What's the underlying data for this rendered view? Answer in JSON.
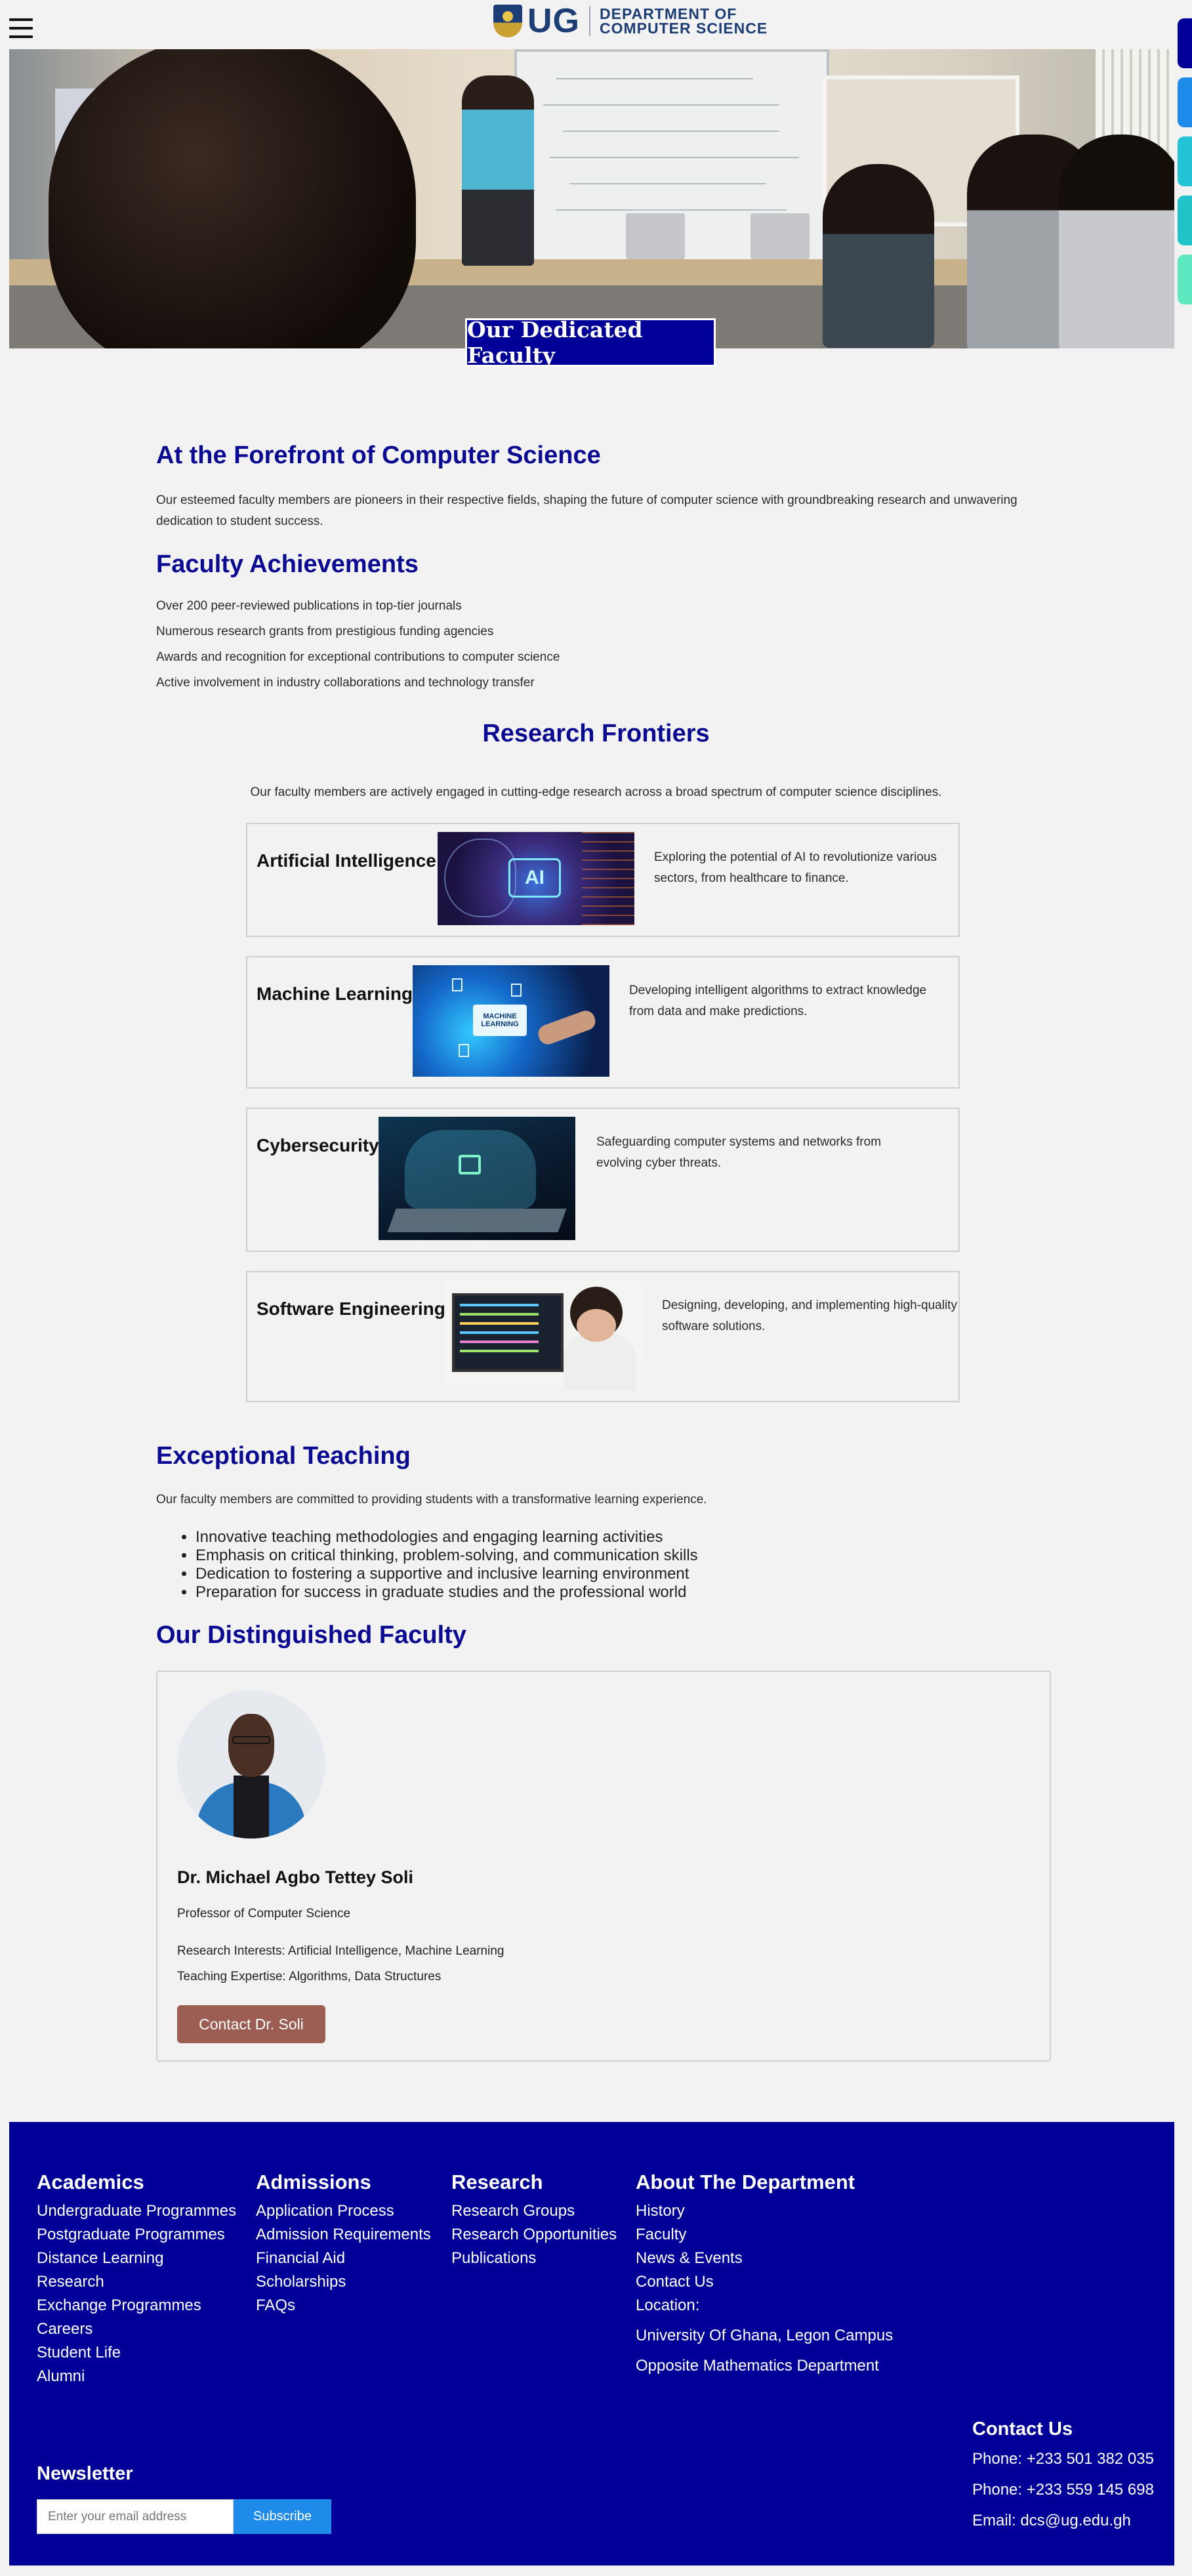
{
  "header": {
    "logo_ug": "UG",
    "logo_dept_line1": "DEPARTMENT OF",
    "logo_dept_line2": "COMPUTER SCIENCE",
    "side_tab_colors": [
      "#000099",
      "#1e8bea",
      "#22c3d6",
      "#20c4c8",
      "#5ee8c0"
    ]
  },
  "hero": {
    "title": "Our Dedicated Faculty"
  },
  "intro": {
    "heading": "At the Forefront of Computer Science",
    "text": "Our esteemed faculty members are pioneers in their respective fields, shaping the future of computer science with groundbreaking research and unwavering dedication to student success."
  },
  "achievements": {
    "heading": "Faculty Achievements",
    "items": [
      "Over 200 peer-reviewed publications in top-tier journals",
      "Numerous research grants from prestigious funding agencies",
      "Awards and recognition for exceptional contributions to computer science",
      "Active involvement in industry collaborations and technology transfer"
    ]
  },
  "research": {
    "heading": "Research Frontiers",
    "intro": "Our faculty members are actively engaged in cutting-edge research across a broad spectrum of computer science disciplines.",
    "areas": [
      {
        "title": "Artificial Intelligence",
        "badge": "AI",
        "desc": "Exploring the potential of AI to revolutionize various sectors, from healthcare to finance."
      },
      {
        "title": "Machine Learning",
        "badge": "MACHINE LEARNING",
        "desc": "Developing intelligent algorithms to extract knowledge from data and make predictions."
      },
      {
        "title": "Cybersecurity",
        "desc": "Safeguarding computer systems and networks from evolving cyber threats."
      },
      {
        "title": "Software Engineering",
        "desc": "Designing, developing, and implementing high-quality software solutions."
      }
    ]
  },
  "teaching": {
    "heading": "Exceptional Teaching",
    "text": "Our faculty members are committed to providing students with a transformative learning experience.",
    "items": [
      "Innovative teaching methodologies and engaging learning activities",
      "Emphasis on critical thinking, problem-solving, and communication skills",
      "Dedication to fostering a supportive and inclusive learning environment",
      "Preparation for success in graduate studies and the professional world"
    ]
  },
  "faculty": {
    "heading": "Our Distinguished Faculty",
    "name": "Dr. Michael Agbo Tettey Soli",
    "role": "Professor of Computer Science",
    "interests": "Research Interests: Artificial Intelligence, Machine Learning",
    "expertise": "Teaching Expertise: Algorithms, Data Structures",
    "button": "Contact Dr. Soli"
  },
  "footer": {
    "academics": {
      "heading": "Academics",
      "links": [
        "Undergraduate Programmes",
        "Postgraduate Programmes",
        "Distance Learning",
        "Research",
        "Exchange Programmes",
        "Careers",
        "Student Life",
        "Alumni"
      ]
    },
    "admissions": {
      "heading": "Admissions",
      "links": [
        "Application Process",
        "Admission Requirements",
        "Financial Aid",
        "Scholarships",
        "FAQs"
      ]
    },
    "research": {
      "heading": "Research",
      "links": [
        "Research Groups",
        "Research Opportunities",
        "Publications"
      ]
    },
    "about": {
      "heading": "About The Department",
      "links": [
        "History",
        "Faculty",
        "News & Events",
        "Contact Us"
      ],
      "location_label": "Location:",
      "address1": "University Of Ghana, Legon Campus",
      "address2": "Opposite Mathematics Department"
    },
    "contact": {
      "heading": "Contact Us",
      "phone1": "Phone: +233 501 382 035",
      "phone2": "Phone: +233 559 145 698",
      "email": "Email: dcs@ug.edu.gh"
    },
    "newsletter": {
      "heading": "Newsletter",
      "placeholder": "Enter your email address",
      "button": "Subscribe"
    }
  }
}
